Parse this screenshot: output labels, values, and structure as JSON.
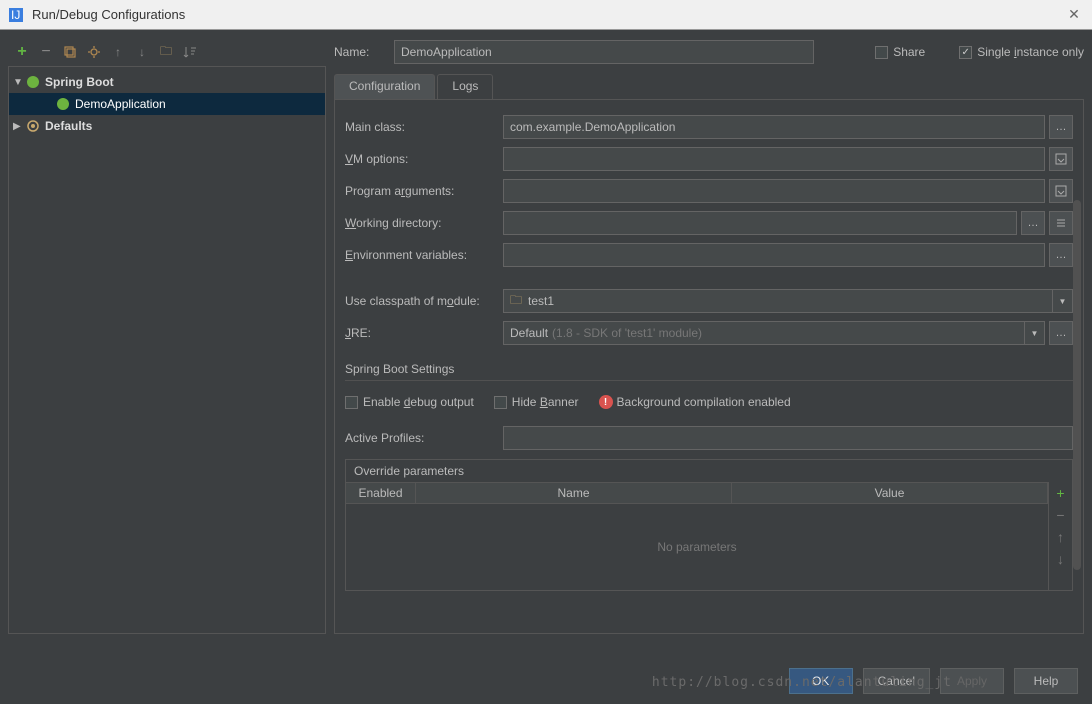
{
  "window": {
    "title": "Run/Debug Configurations"
  },
  "toolbar": {
    "add": "+",
    "remove": "−"
  },
  "tree": {
    "springBoot": "Spring Boot",
    "demoApp": "DemoApplication",
    "defaults": "Defaults"
  },
  "nameRow": {
    "label": "Name:",
    "value": "DemoApplication",
    "share": "Share",
    "singleInstance": "Single instance only"
  },
  "tabs": {
    "configuration": "Configuration",
    "logs": "Logs"
  },
  "form": {
    "mainClass": "Main class:",
    "mainClassValue": "com.example.DemoApplication",
    "vmOptions": "VM options:",
    "programArgs": "Program arguments:",
    "workingDir": "Working directory:",
    "envVars": "Environment variables:",
    "useClasspath": "Use classpath of module:",
    "classpathValue": "test1",
    "jre": "JRE:",
    "jreValue": "Default",
    "jreHint": "(1.8 - SDK of 'test1' module)"
  },
  "springSettings": {
    "title": "Spring Boot Settings",
    "enableDebug": "Enable debug output",
    "hideBanner": "Hide Banner",
    "bgCompile": "Background compilation enabled",
    "activeProfiles": "Active Profiles:"
  },
  "override": {
    "title": "Override parameters",
    "colEnabled": "Enabled",
    "colName": "Name",
    "colValue": "Value",
    "empty": "No parameters"
  },
  "buttons": {
    "ok": "OK",
    "cancel": "Cancel",
    "apply": "Apply",
    "help": "Help"
  },
  "watermark": "http://blog.csdn.net/alantuling_jt"
}
